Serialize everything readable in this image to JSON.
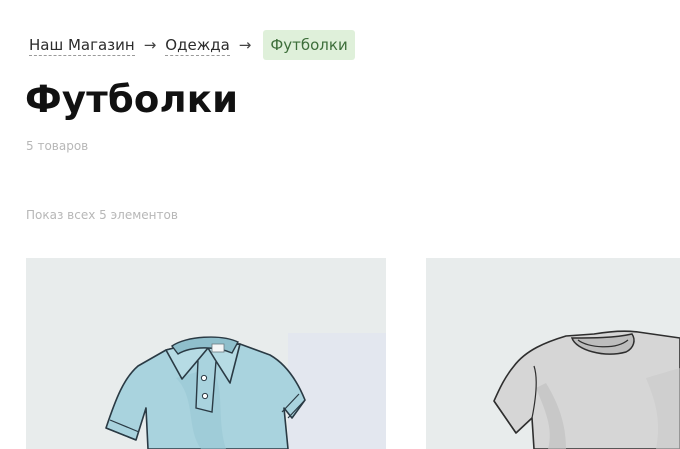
{
  "breadcrumb": {
    "home": "Наш Магазин",
    "category": "Одежда",
    "current": "Футболки",
    "separator": "→"
  },
  "page": {
    "title": "Футболки",
    "count": "5 товаров",
    "result_count": "Показ всех 5 элементов"
  },
  "products": [
    {
      "image": "polo-shirt-blue",
      "color": "#a9d3de"
    },
    {
      "image": "tshirt-grey",
      "color": "#d6d6d6"
    }
  ],
  "colors": {
    "accent_bg": "#dff0da",
    "accent_text": "#3d6e3a",
    "card_bg": "#e8ecec"
  }
}
